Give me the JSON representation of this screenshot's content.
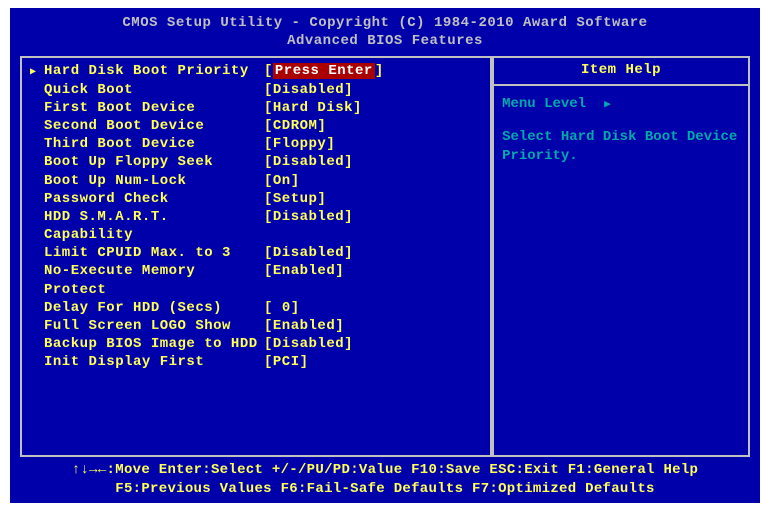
{
  "header": {
    "line1": "CMOS Setup Utility - Copyright (C) 1984-2010 Award Software",
    "line2": "Advanced BIOS Features"
  },
  "menu": [
    {
      "label": "Hard Disk Boot Priority",
      "pre": "[",
      "value": "Press Enter",
      "post": "]",
      "highlight": true,
      "arrow": true
    },
    {
      "label": "Quick Boot",
      "pre": "[",
      "value": "Disabled",
      "post": "]",
      "highlight": false,
      "arrow": false
    },
    {
      "label": "First Boot Device",
      "pre": "[",
      "value": "Hard Disk",
      "post": "]",
      "highlight": false,
      "arrow": false
    },
    {
      "label": "Second Boot Device",
      "pre": "[",
      "value": "CDROM",
      "post": "]",
      "highlight": false,
      "arrow": false
    },
    {
      "label": "Third Boot Device",
      "pre": "[",
      "value": "Floppy",
      "post": "]",
      "highlight": false,
      "arrow": false
    },
    {
      "label": "Boot Up Floppy Seek",
      "pre": "[",
      "value": "Disabled",
      "post": "]",
      "highlight": false,
      "arrow": false
    },
    {
      "label": "Boot Up Num-Lock",
      "pre": "[",
      "value": "On",
      "post": "]",
      "highlight": false,
      "arrow": false
    },
    {
      "label": "Password Check",
      "pre": "[",
      "value": "Setup",
      "post": "]",
      "highlight": false,
      "arrow": false
    },
    {
      "label": "HDD S.M.A.R.T. Capability",
      "pre": "[",
      "value": "Disabled",
      "post": "]",
      "highlight": false,
      "arrow": false
    },
    {
      "label": "Limit CPUID Max. to 3",
      "pre": "[",
      "value": "Disabled",
      "post": "]",
      "highlight": false,
      "arrow": false
    },
    {
      "label": "No-Execute Memory Protect",
      "pre": "[",
      "value": "Enabled",
      "post": "]",
      "highlight": false,
      "arrow": false
    },
    {
      "label": "Delay For HDD (Secs)",
      "pre": "[ ",
      "value": "0",
      "post": "]",
      "highlight": false,
      "arrow": false
    },
    {
      "label": "Full Screen LOGO Show",
      "pre": "[",
      "value": "Enabled",
      "post": "]",
      "highlight": false,
      "arrow": false
    },
    {
      "label": "Backup BIOS Image to HDD",
      "pre": "[",
      "value": "Disabled",
      "post": "]",
      "highlight": false,
      "arrow": false
    },
    {
      "label": "Init Display First",
      "pre": "[",
      "value": "PCI",
      "post": "]",
      "highlight": false,
      "arrow": false
    }
  ],
  "help": {
    "title": "Item Help",
    "level_label": "Menu Level",
    "text": "Select Hard Disk Boot Device Priority."
  },
  "footer": {
    "line1": "↑↓→←:Move  Enter:Select  +/-/PU/PD:Value  F10:Save  ESC:Exit  F1:General Help",
    "line2": "F5:Previous Values  F6:Fail-Safe Defaults  F7:Optimized Defaults"
  }
}
